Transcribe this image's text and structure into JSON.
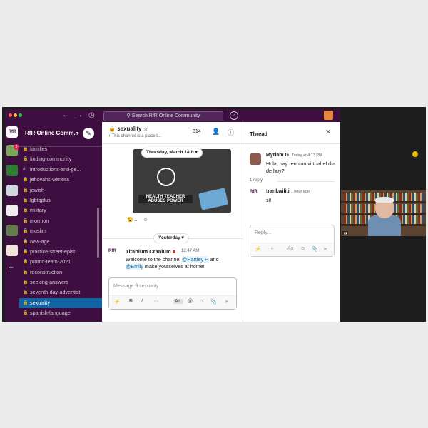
{
  "search": {
    "placeholder": "Search RfR Online Community"
  },
  "workspace": {
    "name": "RfR Online Comm...",
    "rail_badge": "3",
    "logo_text": "RfR"
  },
  "channels": [
    {
      "name": "families",
      "icon": "lock"
    },
    {
      "name": "finding-community",
      "icon": "lock"
    },
    {
      "name": "introductions-and-ge...",
      "icon": "hash"
    },
    {
      "name": "jehovahs-witness",
      "icon": "lock"
    },
    {
      "name": "jewish-",
      "icon": "lock"
    },
    {
      "name": "lgbtqplus",
      "icon": "lock"
    },
    {
      "name": "military",
      "icon": "lock"
    },
    {
      "name": "mormon",
      "icon": "lock"
    },
    {
      "name": "muslim",
      "icon": "lock"
    },
    {
      "name": "new-age",
      "icon": "lock"
    },
    {
      "name": "practice-street-epist...",
      "icon": "lock"
    },
    {
      "name": "promo-team-2021",
      "icon": "lock"
    },
    {
      "name": "reconstruction",
      "icon": "lock"
    },
    {
      "name": "seeking-answers",
      "icon": "lock"
    },
    {
      "name": "seventh-day-adventist",
      "icon": "lock"
    },
    {
      "name": "sexuality",
      "icon": "lock",
      "active": true
    },
    {
      "name": "spanish-language",
      "icon": "lock"
    }
  ],
  "channel": {
    "title": "sexuality",
    "description": "This channel is a place t...",
    "member_count": "314",
    "date_pill": "Thursday, March 18th",
    "image_banner": "HEALTH TEACHER ABUSES POWER",
    "reaction_count": "1",
    "divider_label": "Yesterday",
    "post": {
      "avatar": "RfR",
      "author": "Titanium Cranium",
      "time": "12:47 AM",
      "text_a": "Welcome to the channel ",
      "mention1": "@Hartley F.",
      "text_b": " and ",
      "mention2": "@Emily",
      "text_c": " make yourselves at home!"
    },
    "composer_placeholder": "Message θ sexuality"
  },
  "thread": {
    "title": "Thread",
    "root": {
      "author": "Myriam G.",
      "time": "Today at 4:13 PM",
      "text": "Hola, hay reunión virtual el día de hoy?"
    },
    "replies_label": "1 reply",
    "reply": {
      "avatar": "RfR",
      "author": "trankwiliti",
      "time": "1 hour ago",
      "text": "sí!"
    },
    "composer_placeholder": "Reply..."
  },
  "colors": {
    "sidebar": "#3f0e40",
    "active_channel": "#1164a3",
    "mention": "#1264a3"
  }
}
